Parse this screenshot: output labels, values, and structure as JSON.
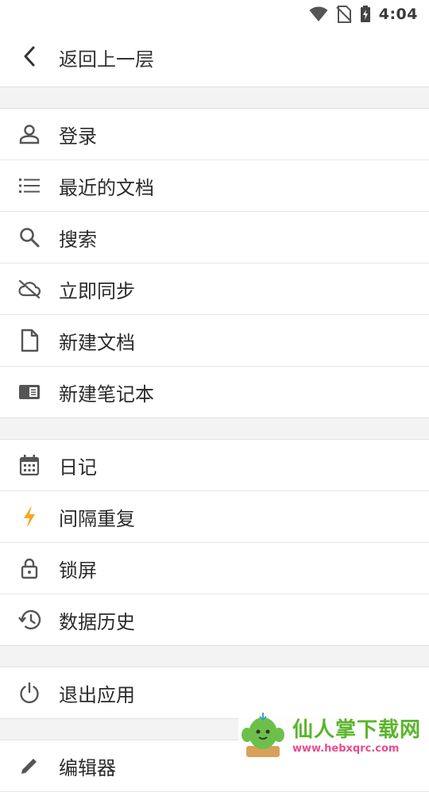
{
  "status_bar": {
    "time": "4:04"
  },
  "header": {
    "back_icon": "chevron-left-icon",
    "title": "返回上一层"
  },
  "group1": [
    {
      "icon": "person-icon",
      "label": "登录"
    },
    {
      "icon": "list-icon",
      "label": "最近的文档"
    },
    {
      "icon": "search-icon",
      "label": "搜索"
    },
    {
      "icon": "cloud-off-icon",
      "label": "立即同步"
    },
    {
      "icon": "document-icon",
      "label": "新建文档"
    },
    {
      "icon": "notebook-icon",
      "label": "新建笔记本"
    }
  ],
  "group2": [
    {
      "icon": "calendar-icon",
      "label": "日记"
    },
    {
      "icon": "lightning-icon",
      "label": "间隔重复",
      "color": "#f5a623"
    },
    {
      "icon": "lock-icon",
      "label": "锁屏"
    },
    {
      "icon": "history-icon",
      "label": "数据历史"
    }
  ],
  "group3": [
    {
      "icon": "power-icon",
      "label": "退出应用"
    }
  ],
  "group4": [
    {
      "icon": "edit-icon",
      "label": "编辑器"
    }
  ],
  "watermark": {
    "title": "仙人掌下载网",
    "url": "www.hebxqrc.com"
  }
}
